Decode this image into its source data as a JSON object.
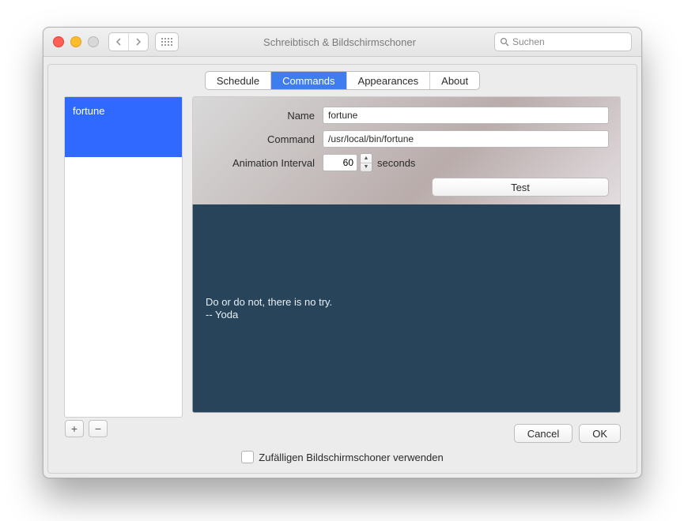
{
  "window_title": "Schreibtisch & Bildschirmschoner",
  "search_placeholder": "Suchen",
  "tabs": [
    "Schedule",
    "Commands",
    "Appearances",
    "About"
  ],
  "active_tab": 1,
  "sidebar": {
    "items": [
      "fortune"
    ]
  },
  "form": {
    "name_label": "Name",
    "name_value": "fortune",
    "command_label": "Command",
    "command_value": "/usr/local/bin/fortune",
    "interval_label": "Animation Interval",
    "interval_value": "60",
    "interval_unit": "seconds",
    "test_label": "Test"
  },
  "preview_text": "Do or do not, there is no try.\n-- Yoda",
  "buttons": {
    "cancel": "Cancel",
    "ok": "OK"
  },
  "random_label": "Zufälligen Bildschirmschoner verwenden",
  "icons": {
    "add": "+",
    "remove": "−"
  }
}
